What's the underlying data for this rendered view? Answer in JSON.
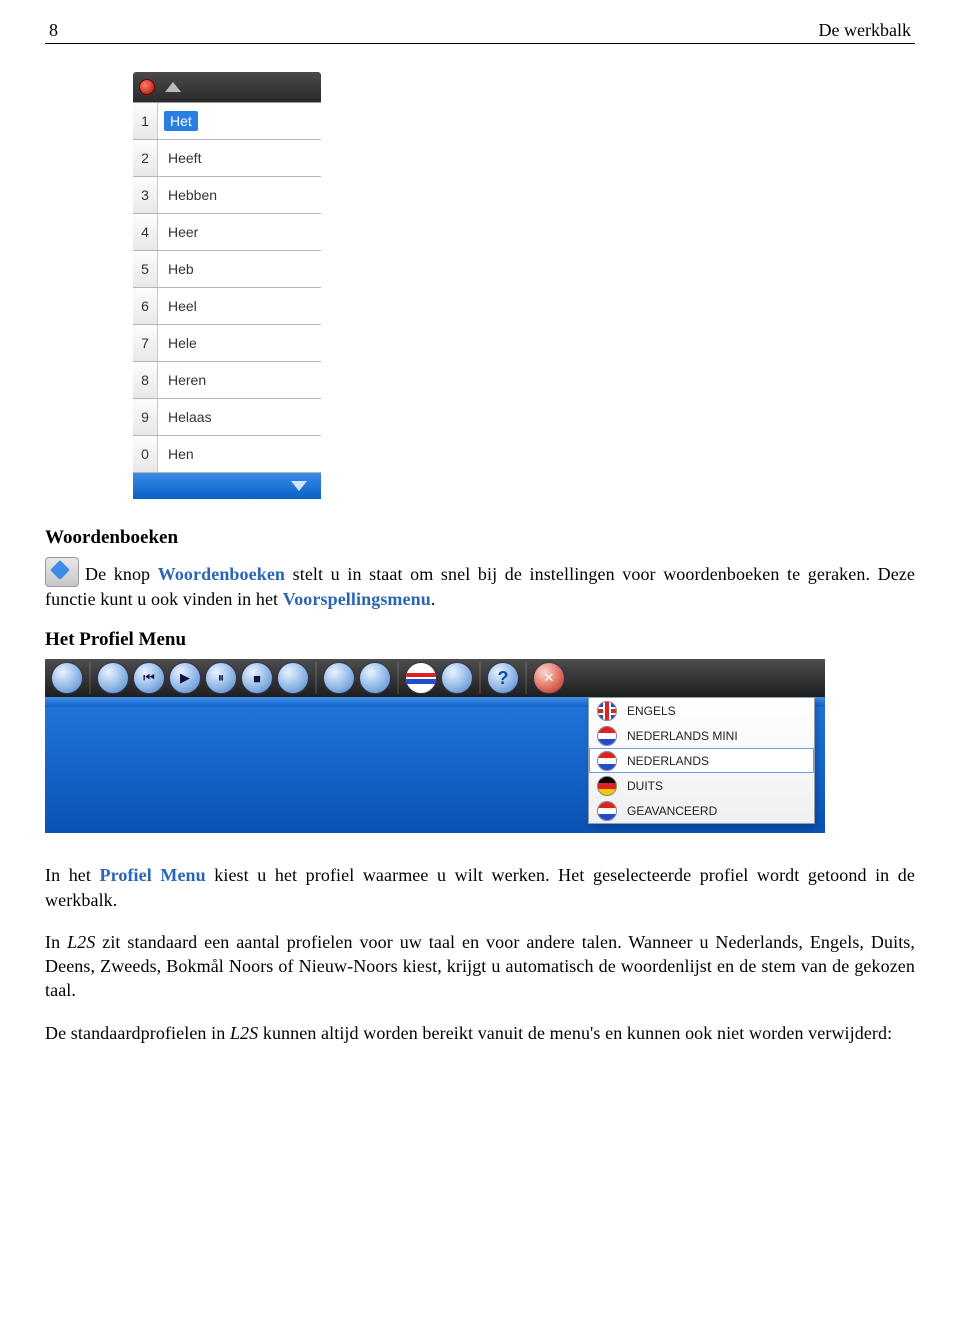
{
  "header": {
    "page_number": "8",
    "title": "De werkbalk"
  },
  "wordlist": {
    "items": [
      {
        "num": "1",
        "word": "Het",
        "selected": true
      },
      {
        "num": "2",
        "word": "Heeft"
      },
      {
        "num": "3",
        "word": "Hebben"
      },
      {
        "num": "4",
        "word": "Heer"
      },
      {
        "num": "5",
        "word": "Heb"
      },
      {
        "num": "6",
        "word": "Heel"
      },
      {
        "num": "7",
        "word": "Hele"
      },
      {
        "num": "8",
        "word": "Heren"
      },
      {
        "num": "9",
        "word": "Helaas"
      },
      {
        "num": "0",
        "word": "Hen"
      }
    ]
  },
  "section1": {
    "heading": "Woordenboeken",
    "p1a": "De knop ",
    "p1link": "Woordenboeken",
    "p1b": " stelt u in staat om snel bij de instellingen voor woordenboeken te geraken. Deze functie kunt u ook vinden in het ",
    "p1link2": "Voorspellingsmenu",
    "p1c": "."
  },
  "section2": {
    "heading": "Het Profiel Menu"
  },
  "profile_menu": {
    "items": [
      {
        "flag": "uk",
        "label": "ENGELS"
      },
      {
        "flag": "nl",
        "label": "NEDERLANDS MINI"
      },
      {
        "flag": "nl",
        "label": "NEDERLANDS",
        "selected": true
      },
      {
        "flag": "de",
        "label": "DUITS"
      },
      {
        "flag": "nl",
        "label": "GEAVANCEERD"
      }
    ]
  },
  "section3": {
    "p1a": "In het ",
    "p1link": "Profiel Menu",
    "p1b": " kiest u het profiel waarmee u wilt werken. Het geselecteerde profiel wordt getoond in de werkbalk.",
    "p2a": "In ",
    "p2it": "L2S",
    "p2b": " zit standaard een aantal profielen voor uw taal en voor andere talen. Wanneer u Nederlands, Engels, Duits, Deens, Zweeds, Bokmål Noors of Nieuw-Noors kiest, krijgt u automatisch de woordenlijst en de stem van de gekozen taal.",
    "p3a": "De standaardprofielen in ",
    "p3it": "L2S",
    "p3b": " kunnen altijd worden bereikt vanuit de menu's en kunnen ook niet worden verwijderd:"
  }
}
